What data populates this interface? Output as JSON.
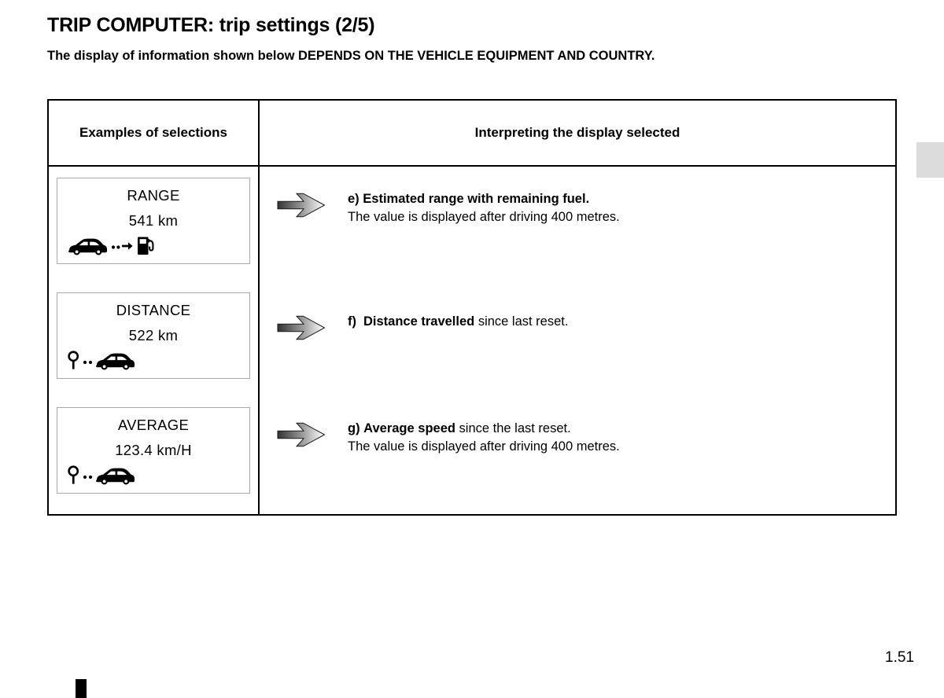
{
  "page": {
    "title": "TRIP COMPUTER: trip settings (2/5)",
    "subtitle": "The display of information shown below DEPENDS ON THE VEHICLE EQUIPMENT AND COUNTRY.",
    "page_number": "1.51"
  },
  "table": {
    "headers": {
      "left": "Examples of selections",
      "right": "Interpreting the display selected"
    },
    "selections": [
      {
        "title": "RANGE",
        "value": "541 km",
        "icons": [
          "car-icon",
          "dots-icon",
          "arrow-right-icon",
          "fuel-pump-icon"
        ]
      },
      {
        "title": "DISTANCE",
        "value": "522 km",
        "icons": [
          "map-pin-icon",
          "dots-icon",
          "car-icon"
        ]
      },
      {
        "title": "AVERAGE",
        "value": "123.4 km/H",
        "icons": [
          "map-pin-icon",
          "dots-icon",
          "car-icon"
        ]
      }
    ],
    "interpretations": [
      {
        "marker": "e)",
        "bold_text": "Estimated range with remaining fuel.",
        "rest_text": "",
        "second_line": "The value is displayed after driving 400 metres."
      },
      {
        "marker": "f)",
        "bold_text": "Distance travelled",
        "rest_text": " since last reset.",
        "second_line": ""
      },
      {
        "marker": "g)",
        "bold_text": "Average speed",
        "rest_text": " since the last reset.",
        "second_line": "The value is displayed after driving 400 metres."
      }
    ]
  },
  "colors": {
    "border": "#000000",
    "box_border": "#a8a8a8",
    "side_tab": "#dcdcdc",
    "arrow_dark": "#4d4d4d",
    "arrow_light": "#ffffff"
  }
}
